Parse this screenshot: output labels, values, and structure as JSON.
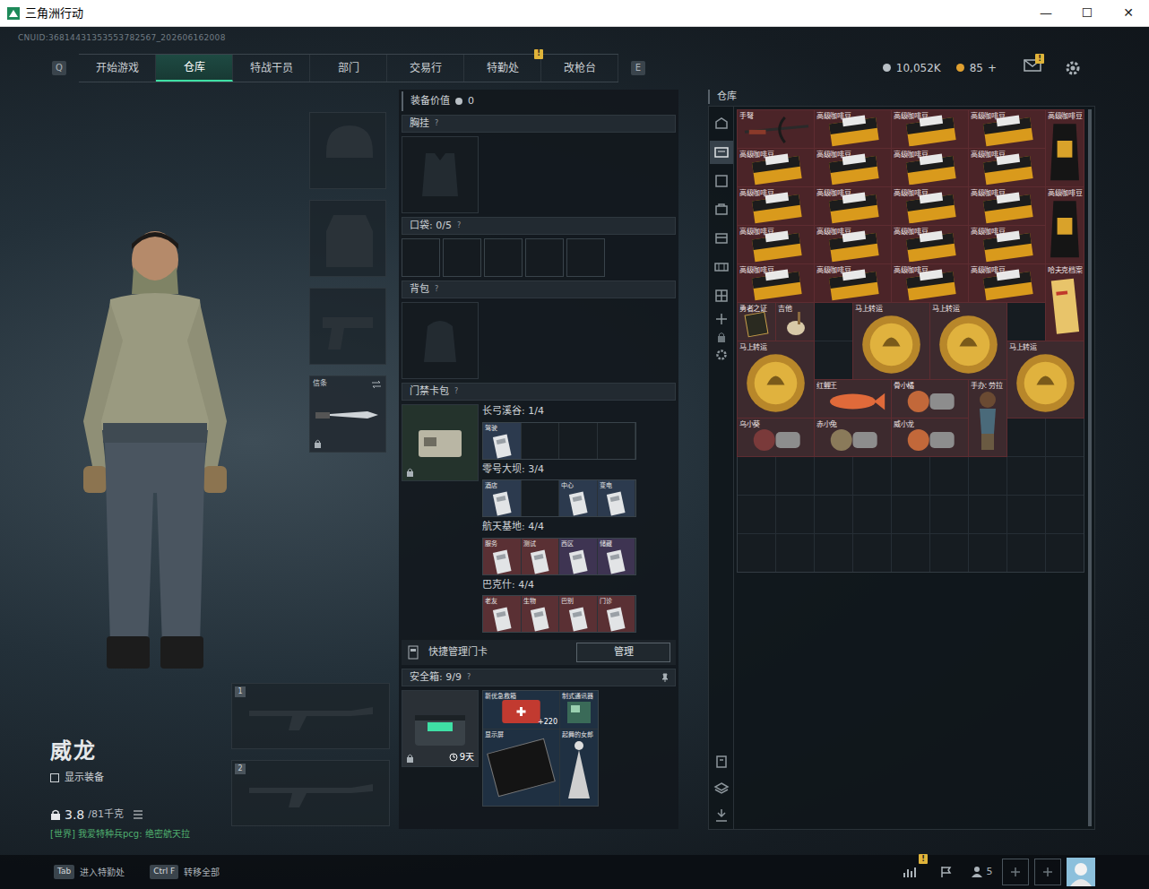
{
  "window": {
    "title": "三角洲行动",
    "controls": [
      "—",
      "☐",
      "✕"
    ]
  },
  "uid": "CNUID:36814431353553782567_202606162008",
  "nav": {
    "left_key": "Q",
    "right_key": "E",
    "tabs": [
      {
        "label": "开始游戏",
        "selected": false
      },
      {
        "label": "仓库",
        "selected": true
      },
      {
        "label": "特战干员",
        "selected": false
      },
      {
        "label": "部门",
        "selected": false
      },
      {
        "label": "交易行",
        "selected": false
      },
      {
        "label": "特勤处",
        "selected": false,
        "badge": "!"
      },
      {
        "label": "改枪台",
        "selected": false
      }
    ],
    "currency": [
      {
        "value": "10,052K"
      },
      {
        "value": "85",
        "action": "+"
      }
    ],
    "mail_badge": "!"
  },
  "operator": {
    "name": "威龙",
    "show_gear": {
      "label": "显示装备",
      "checked": false
    },
    "weight": "3.8",
    "weight_max": "/81千克",
    "chat": "[世界] 我爱特种兵pcg: 绝密航天拉"
  },
  "equipment": {
    "melee": {
      "label": "信条",
      "locked": true
    },
    "weapon_slots": [
      "1",
      "2"
    ]
  },
  "loadout": {
    "value_label": "装备价值",
    "value": "0",
    "chest": {
      "label": "胸挂",
      "help": "?"
    },
    "pockets": {
      "label": "口袋: 0/5",
      "help": "?"
    },
    "backpack": {
      "label": "背包",
      "help": "?"
    },
    "keycards": {
      "label": "门禁卡包",
      "help": "?",
      "locked": true,
      "maps": [
        {
          "title": "长弓溪谷: 1/4",
          "cards": [
            {
              "label": "驾驶",
              "filled": true,
              "color": "#2c3a4e"
            },
            {
              "filled": false
            },
            {
              "filled": false
            },
            {
              "filled": false
            }
          ]
        },
        {
          "title": "零号大坝: 3/4",
          "cards": [
            {
              "label": "酒店",
              "filled": true,
              "color": "#2c3a4e"
            },
            {
              "filled": false
            },
            {
              "label": "中心",
              "filled": true,
              "color": "#2c3a4e"
            },
            {
              "label": "变电",
              "filled": true,
              "color": "#2c3a4e"
            }
          ]
        },
        {
          "title": "航天基地: 4/4",
          "cards": [
            {
              "label": "服务",
              "filled": true,
              "color": "#5a3034"
            },
            {
              "label": "测试",
              "filled": true,
              "color": "#5a3034"
            },
            {
              "label": "西区",
              "filled": true,
              "color": "#3e3452"
            },
            {
              "label": "储藏",
              "filled": true,
              "color": "#3e3452"
            }
          ]
        },
        {
          "title": "巴克什: 4/4",
          "cards": [
            {
              "label": "老友",
              "filled": true,
              "color": "#5a3034"
            },
            {
              "label": "生物",
              "filled": true,
              "color": "#5a3034"
            },
            {
              "label": "巴别",
              "filled": true,
              "color": "#5a3034"
            },
            {
              "label": "门诊",
              "filled": true,
              "color": "#5a3034"
            }
          ]
        }
      ]
    },
    "quick": {
      "label": "快捷管理门卡",
      "button": "管理"
    },
    "safe": {
      "label": "安全箱: 9/9",
      "help": "?",
      "timer": "9天",
      "locked": true,
      "items": [
        {
          "label": "新优急救箱",
          "kind": "medkit",
          "extra": "+220"
        },
        {
          "label": "制式通讯器",
          "kind": "device"
        },
        {
          "label": "显示屏",
          "kind": "screen"
        },
        {
          "label": "起舞的女郎",
          "kind": "dancer"
        }
      ]
    }
  },
  "warehouse": {
    "title": "仓库",
    "side_tabs": [
      {
        "selected": false
      },
      {
        "selected": true
      },
      {
        "selected": false
      },
      {
        "selected": false
      },
      {
        "selected": false
      },
      {
        "selected": false
      },
      {
        "selected": false
      }
    ],
    "items": [
      {
        "label": "手弩",
        "kind": "crossbow"
      },
      {
        "label": "高级咖啡豆",
        "kind": "box"
      },
      {
        "label": "高级咖啡豆",
        "kind": "box"
      },
      {
        "label": "高级咖啡豆",
        "kind": "box"
      },
      {
        "label": "高级咖啡豆",
        "kind": "bag"
      },
      {
        "label": "高级咖啡豆",
        "kind": "box"
      },
      {
        "label": "高级咖啡豆",
        "kind": "box"
      },
      {
        "label": "高级咖啡豆",
        "kind": "box"
      },
      {
        "label": "高级咖啡豆",
        "kind": "box"
      },
      {
        "label": "高级咖啡豆",
        "kind": "box"
      },
      {
        "label": "高级咖啡豆",
        "kind": "box"
      },
      {
        "label": "高级咖啡豆",
        "kind": "box"
      },
      {
        "label": "高级咖啡豆",
        "kind": "box"
      },
      {
        "label": "高级咖啡豆",
        "kind": "bag"
      },
      {
        "label": "高级咖啡豆",
        "kind": "box"
      },
      {
        "label": "高级咖啡豆",
        "kind": "box"
      },
      {
        "label": "高级咖啡豆",
        "kind": "box"
      },
      {
        "label": "高级咖啡豆",
        "kind": "box"
      },
      {
        "label": "高级咖啡豆",
        "kind": "box"
      },
      {
        "label": "高级咖啡豆",
        "kind": "box"
      },
      {
        "label": "高级咖啡豆",
        "kind": "box"
      },
      {
        "label": "高级咖啡豆",
        "kind": "box"
      },
      {
        "label": "哈夫克档案",
        "kind": "doc"
      },
      {
        "label": "勇者之证",
        "kind": "medal"
      },
      {
        "label": "吉他",
        "kind": "guitar"
      },
      {
        "label": "马上转运",
        "kind": "coin"
      },
      {
        "label": "马上转运",
        "kind": "coin"
      },
      {
        "label": "马上转运",
        "kind": "coin"
      },
      {
        "label": "马上转运",
        "kind": "coin"
      },
      {
        "label": "红鲤王",
        "kind": "fish"
      },
      {
        "label": "骨小橘",
        "kind": "plush"
      },
      {
        "label": "手办: 劳拉",
        "kind": "figure"
      },
      {
        "label": "乌小葵",
        "kind": "plush"
      },
      {
        "label": "赤小兔",
        "kind": "plush"
      },
      {
        "label": "威小龙",
        "kind": "plush"
      }
    ]
  },
  "bottom": {
    "hints": [
      {
        "key": "Tab",
        "label": "进入特勤处"
      },
      {
        "key": "Ctrl F",
        "label": "转移全部"
      }
    ],
    "stats_badge": "!",
    "friends": "5"
  }
}
